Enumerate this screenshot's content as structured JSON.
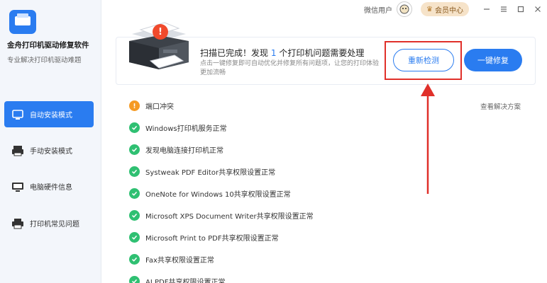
{
  "app": {
    "title": "金舟打印机驱动修复软件",
    "subtitle": "专业解决打印机驱动难题"
  },
  "titlebar": {
    "user_name": "微信用户",
    "member_label": "会员中心",
    "controls": [
      "minimize-icon",
      "menu-icon",
      "maximize-icon",
      "close-icon"
    ]
  },
  "sidebar": {
    "items": [
      {
        "label": "自动安装模式",
        "icon": "auto-install-icon",
        "active": true
      },
      {
        "label": "手动安装模式",
        "icon": "manual-install-icon",
        "active": false
      },
      {
        "label": "电脑硬件信息",
        "icon": "hardware-icon",
        "active": false
      },
      {
        "label": "打印机常见问题",
        "icon": "printer-faq-icon",
        "active": false
      }
    ]
  },
  "banner": {
    "title_before": "扫描已完成！发现",
    "issue_count": "1",
    "title_after": "个打印机问题需要处理",
    "description": "点击一键修复即可自动优化并修复所有问题项，让您的打印体验更加流畅",
    "recheck_label": "重新检测",
    "fix_label": "一键修复"
  },
  "issues": {
    "view_solution_label": "查看解决方案",
    "rows": [
      {
        "text": "端口冲突",
        "status": "warning"
      },
      {
        "text": "Windows打印机服务正常",
        "status": "ok"
      },
      {
        "text": "发现电脑连接打印机正常",
        "status": "ok"
      },
      {
        "text": "Systweak PDF Editor共享权限设置正常",
        "status": "ok"
      },
      {
        "text": "OneNote for Windows 10共享权限设置正常",
        "status": "ok"
      },
      {
        "text": "Microsoft XPS Document Writer共享权限设置正常",
        "status": "ok"
      },
      {
        "text": "Microsoft Print to PDF共享权限设置正常",
        "status": "ok"
      },
      {
        "text": "Fax共享权限设置正常",
        "status": "ok"
      },
      {
        "text": "AI PDF共享权限设置正常",
        "status": "ok"
      }
    ]
  },
  "colors": {
    "accent": "#2a7cf0",
    "ok": "#2fc072",
    "warning": "#f59a23",
    "alert": "#f04a2c",
    "annotation": "#e0302a"
  }
}
